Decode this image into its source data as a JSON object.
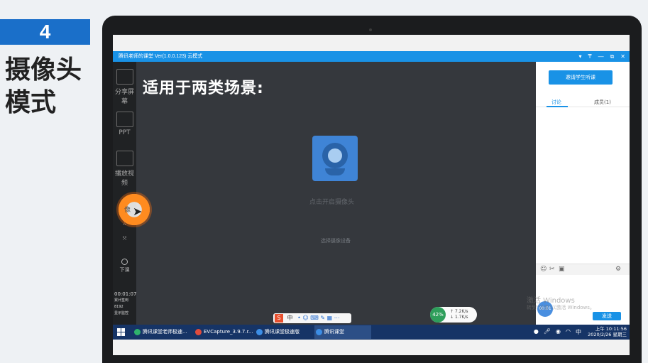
{
  "slide": {
    "badge_number": "4",
    "title_line1": "摄像头",
    "title_line2": "模式"
  },
  "app": {
    "window_title": "腾讯老师的课堂 Ver(1.0.0.123)  云模式",
    "controls": [
      "▾",
      "₸",
      "—",
      "⧉",
      "✕"
    ],
    "stage_heading": "适用于两类场景:",
    "camera_hint": "点击开启摄像头",
    "device_hint": "选择摄像设备",
    "left_rail": {
      "share_screen": "分享屏幕",
      "ppt": "PPT",
      "play_video": "播放视频",
      "camera": "像",
      "class_end": "下课"
    },
    "timer": {
      "elapsed": "00:01:07",
      "count_label": "累计签到",
      "count_value": "8192",
      "live_label": "显示监控"
    },
    "right_panel": {
      "invite_button": "邀请学生听课",
      "tab_discuss": "讨论",
      "tab_members": "成员(1)",
      "send_button": "发送"
    },
    "watermark_line1": "激活 Windows",
    "watermark_line2": "转到\"设置\"以激活 Windows。",
    "ime": "中",
    "net": {
      "percent": "42%",
      "up": "7.2K/s",
      "down": "1.7K/s"
    },
    "avatar_time": "00:01"
  },
  "taskbar": {
    "apps": [
      {
        "label": "腾讯课堂老师极速...",
        "color": "#2fb36c"
      },
      {
        "label": "EVCapture_3.9.7.r...",
        "color": "#e04b3c"
      },
      {
        "label": "腾讯课堂极速版",
        "color": "#3c8ee6"
      },
      {
        "label": "腾讯课堂",
        "color": "#3c8ee6"
      }
    ],
    "ime": "中",
    "clock_time": "上午 10:11:56",
    "clock_date": "2020/2/26 星期三"
  }
}
